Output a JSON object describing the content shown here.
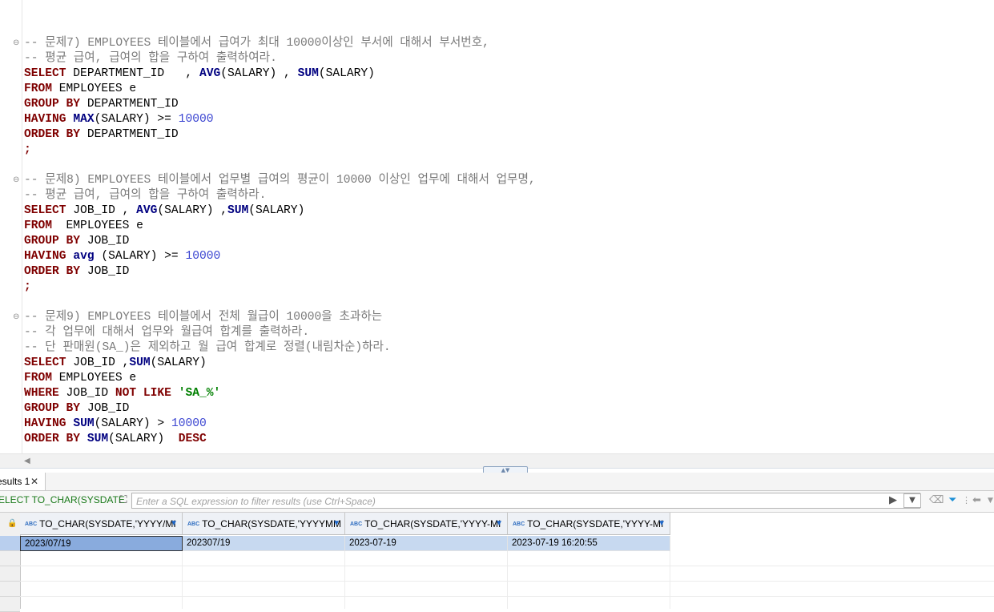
{
  "editor": {
    "lines": {
      "l1": "-- 문제7) EMPLOYEES 테이블에서 급여가 최대 10000이상인 부서에 대해서 부서번호,",
      "l2": "-- 평균 급여, 급여의 합을 구하여 출력하여라.",
      "l10": "-- 문제8) EMPLOYEES 테이블에서 업무별 급여의 평균이 10000 이상인 업무에 대해서 업무명,",
      "l11": "-- 평균 급여, 급여의 합을 구하여 출력하라.",
      "l19": "-- 문제9) EMPLOYEES 테이블에서 전체 월급이 10000을 초과하는",
      "l20": "-- 각 업무에 대해서 업무와 월급여 합계를 출력하라.",
      "l21": "-- 단 판매원(SA_)은 제외하고 월 급여 합계로 정렬(내림차순)하라."
    }
  },
  "results": {
    "tab_label": "esults 1",
    "tab_close": "✕",
    "query_preview": "ELECT TO_CHAR(SYSDATE",
    "filter_placeholder": "Enter a SQL expression to filter results (use Ctrl+Space)",
    "columns": [
      "TO_CHAR(SYSDATE,'YYYY/MI",
      "TO_CHAR(SYSDATE,'YYYYMM",
      "TO_CHAR(SYSDATE,'YYYY-MI",
      "TO_CHAR(SYSDATE,'YYYY-MI"
    ],
    "rows": [
      [
        "2023/07/19",
        "202307/19",
        "2023-07-19",
        "2023-07-19 16:20:55"
      ]
    ]
  }
}
